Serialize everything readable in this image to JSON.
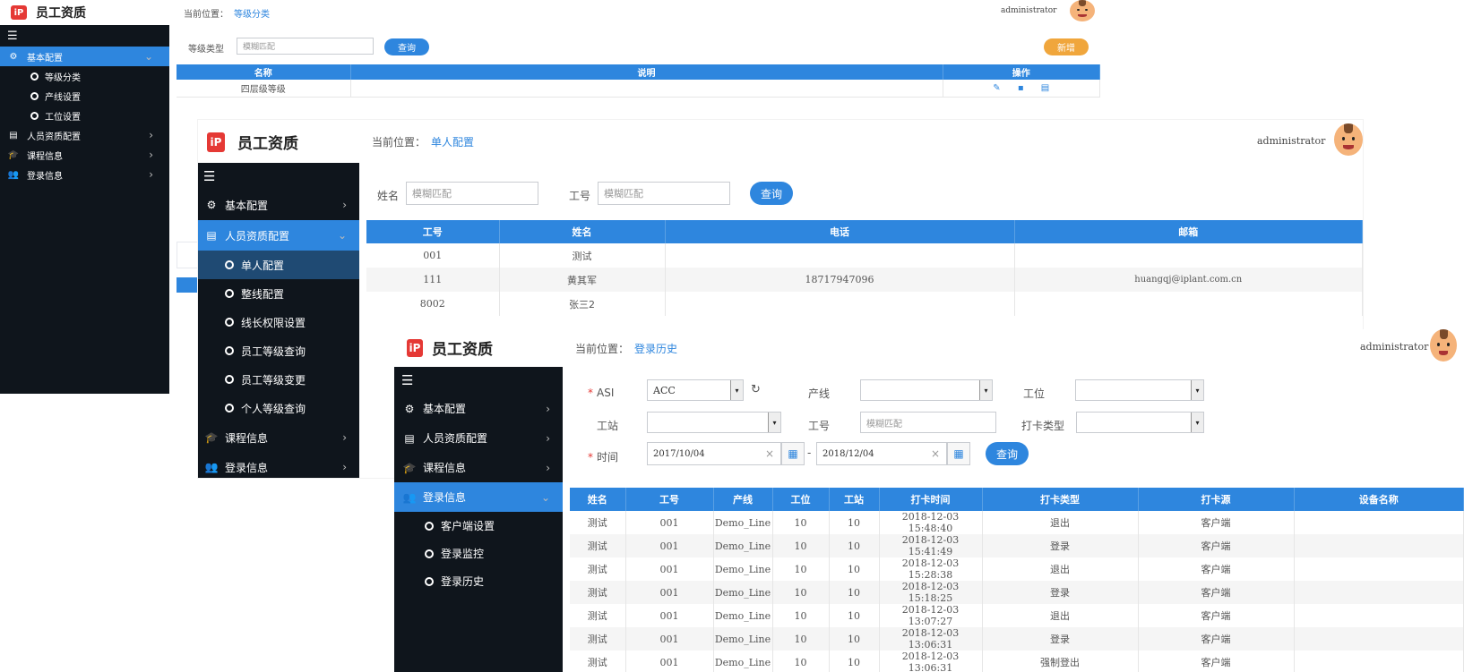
{
  "app_title": "员工资质",
  "logo_text": "iP",
  "crumb_label": "当前位置：",
  "user": "administrator",
  "menu_toggle_icon": "☰",
  "accent_color": "#2e86de",
  "sidebar_bg": "#0f151c",
  "shot1": {
    "crumb_current": "等级分类",
    "sidebar": {
      "basic": "基本配置",
      "sub": [
        "等级分类",
        "产线设置",
        "工位设置"
      ],
      "hr": "人员资质配置",
      "course": "课程信息",
      "login": "登录信息"
    },
    "filter_label": "等级类型",
    "filter_placeholder": "模糊匹配",
    "query": "查询",
    "add": "新增",
    "table": {
      "headers": [
        "名称",
        "说明",
        "操作"
      ],
      "rows": [
        [
          "四层级等级",
          ""
        ]
      ]
    }
  },
  "shot2": {
    "crumb_current": "单人配置",
    "sidebar": {
      "basic": "基本配置",
      "hr": "人员资质配置",
      "sub": [
        "单人配置",
        "整线配置",
        "线长权限设置",
        "员工等级查询",
        "员工等级变更",
        "个人等级查询"
      ],
      "course": "课程信息",
      "login": "登录信息"
    },
    "name_label": "姓名",
    "name_placeholder": "模糊匹配",
    "id_label": "工号",
    "id_placeholder": "模糊匹配",
    "query": "查询",
    "table": {
      "headers": [
        "工号",
        "姓名",
        "电话",
        "邮箱"
      ],
      "rows": [
        [
          "001",
          "测试",
          "",
          ""
        ],
        [
          "111",
          "黄其军",
          "18717947096",
          "huangqj@iplant.com.cn"
        ],
        [
          "8002",
          "张三2",
          "",
          ""
        ]
      ]
    }
  },
  "shot3": {
    "crumb_current": "登录历史",
    "sidebar": {
      "basic": "基本配置",
      "hr": "人员资质配置",
      "course": "课程信息",
      "login": "登录信息",
      "sub": [
        "客户端设置",
        "登录监控",
        "登录历史"
      ]
    },
    "filters": {
      "asi_label": "ASI",
      "asi_value": "ACC",
      "line_label": "产线",
      "post_label": "工位",
      "station_label": "工站",
      "id_label": "工号",
      "id_placeholder": "模糊匹配",
      "punch_type_label": "打卡类型",
      "time_label": "时间",
      "date_from": "2017/10/04",
      "date_to": "2018/12/04",
      "date_sep": "-",
      "query": "查询"
    },
    "table": {
      "headers": [
        "姓名",
        "工号",
        "产线",
        "工位",
        "工站",
        "打卡时间",
        "打卡类型",
        "打卡源",
        "设备名称"
      ],
      "rows": [
        [
          "测试",
          "001",
          "Demo_Line",
          "10",
          "10",
          "2018-12-03 15:48:40",
          "退出",
          "客户端",
          ""
        ],
        [
          "测试",
          "001",
          "Demo_Line",
          "10",
          "10",
          "2018-12-03 15:41:49",
          "登录",
          "客户端",
          ""
        ],
        [
          "测试",
          "001",
          "Demo_Line",
          "10",
          "10",
          "2018-12-03 15:28:38",
          "退出",
          "客户端",
          ""
        ],
        [
          "测试",
          "001",
          "Demo_Line",
          "10",
          "10",
          "2018-12-03 15:18:25",
          "登录",
          "客户端",
          ""
        ],
        [
          "测试",
          "001",
          "Demo_Line",
          "10",
          "10",
          "2018-12-03 13:07:27",
          "退出",
          "客户端",
          ""
        ],
        [
          "测试",
          "001",
          "Demo_Line",
          "10",
          "10",
          "2018-12-03 13:06:31",
          "登录",
          "客户端",
          ""
        ],
        [
          "测试",
          "001",
          "Demo_Line",
          "10",
          "10",
          "2018-12-03 13:06:31",
          "强制登出",
          "客户端",
          ""
        ]
      ]
    }
  }
}
